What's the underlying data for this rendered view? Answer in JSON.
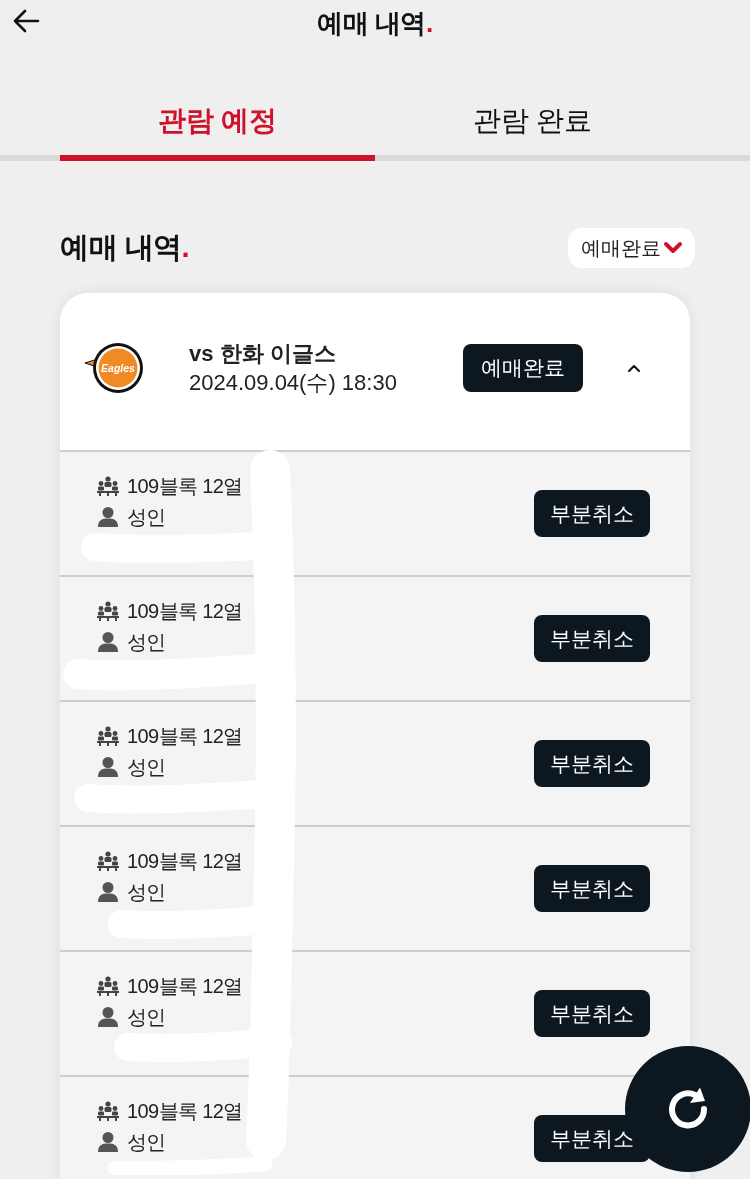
{
  "header": {
    "title": "예매 내역",
    "title_accent": "."
  },
  "tabs": [
    {
      "label": "관람 예정",
      "selected": true
    },
    {
      "label": "관람 완료",
      "selected": false
    }
  ],
  "section": {
    "title": "예매 내역",
    "title_accent": ".",
    "filter": {
      "label": "예매완료"
    }
  },
  "booking": {
    "logo_text": "Eagles",
    "opponent": "vs 한화 이글스",
    "datetime": "2024.09.04(수) 18:30",
    "status": "예매완료",
    "expanded": true,
    "tickets": [
      {
        "seat": "109블록 12열",
        "type": "성인",
        "action": "부분취소"
      },
      {
        "seat": "109블록 12열",
        "type": "성인",
        "action": "부분취소"
      },
      {
        "seat": "109블록 12열",
        "type": "성인",
        "action": "부분취소"
      },
      {
        "seat": "109블록 12열",
        "type": "성인",
        "action": "부분취소"
      },
      {
        "seat": "109블록 12열",
        "type": "성인",
        "action": "부분취소"
      },
      {
        "seat": "109블록 12열",
        "type": "성인",
        "action": "부분취소"
      }
    ]
  }
}
